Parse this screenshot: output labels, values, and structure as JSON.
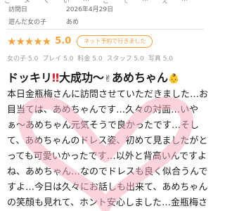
{
  "top_fragment": [
    "ご",
    "メ",
    "く",
    "い",
    "…",
    "ご",
    "て",
    "…",
    "え",
    "…"
  ],
  "details": [
    {
      "label": "訪問日",
      "value": "2026年4月29日"
    },
    {
      "label": "遊んだ女の子",
      "value": "あめ"
    }
  ],
  "rating": {
    "stars": "★★★★★",
    "score": "5.0",
    "badge": "ネット予約で行きました"
  },
  "subscores": [
    "女の子 5.0",
    "プレイ 5.0",
    "料金 5.0",
    "スタッフ 5.0",
    "写真 5.0"
  ],
  "review": {
    "title_part1": "ドッキリ",
    "title_marks": "‼",
    "title_part2": "大成功〜",
    "title_emoji1": "✌",
    "title_part3": "あめちゃん",
    "title_emoji2": "👶",
    "lines": [
      "本日金瓶梅さんに訪問させていただきました…お",
      "目当ては、あめちゃんです…久々の対面…いや",
      "ぁ〜あめちゃん元気そうで良かったです…そし",
      "て、あめちゃんのドレス姿、初めて見ましたがと",
      "っても可愛いかったです…以外と背高いんですよ",
      "ね、あめちゃん…なのでドレスも良く似合うんで",
      "すよ…今日は久々にお話しも出来て、あめちゃん",
      "の笑顔も見れて、ホント安心しました…金瓶梅さ"
    ]
  },
  "colors": {
    "accent": "#f5a13c",
    "title_red": "#e31b23",
    "heart_pink": "#f7a8b8"
  }
}
